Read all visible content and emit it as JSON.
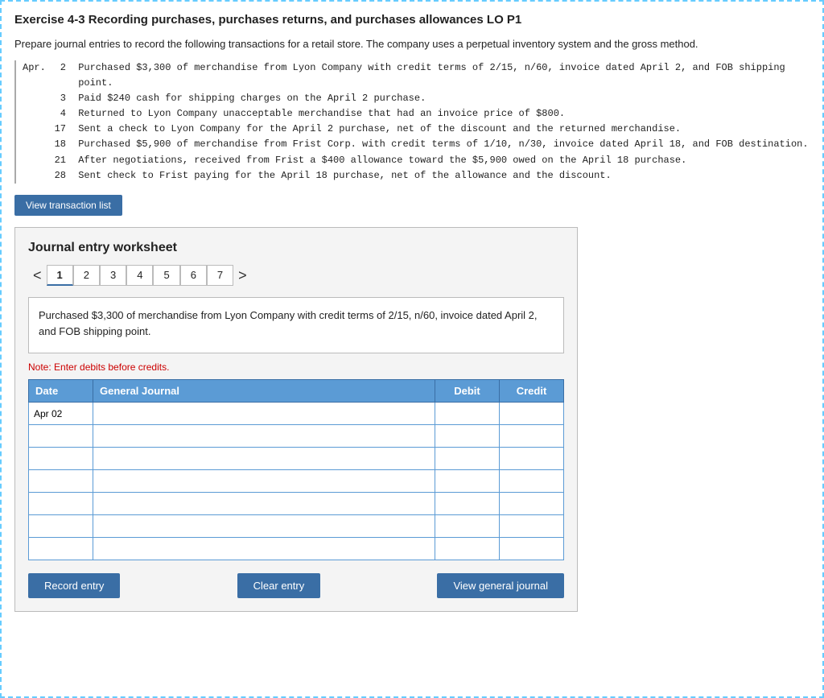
{
  "exercise": {
    "title": "Exercise 4-3 Recording purchases, purchases returns, and purchases allowances LO P1",
    "intro": "Prepare journal entries to record the following transactions for a retail store. The company uses a perpetual inventory system and the gross method.",
    "transactions": [
      {
        "month": "Apr.",
        "day": "2",
        "text": "Purchased $3,300 of merchandise from Lyon Company with credit terms of 2/15, n/60, invoice dated April 2, and FOB shipping point."
      },
      {
        "month": "",
        "day": "3",
        "text": "Paid $240 cash for shipping charges on the April 2 purchase."
      },
      {
        "month": "",
        "day": "4",
        "text": "Returned to Lyon Company unacceptable merchandise that had an invoice price of $800."
      },
      {
        "month": "",
        "day": "17",
        "text": "Sent a check to Lyon Company for the April 2 purchase, net of the discount and the returned merchandise."
      },
      {
        "month": "",
        "day": "18",
        "text": "Purchased $5,900 of merchandise from Frist Corp. with credit terms of 1/10, n/30, invoice dated April 18, and FOB destination."
      },
      {
        "month": "",
        "day": "21",
        "text": "After negotiations, received from Frist a $400 allowance toward the $5,900 owed on the April 18 purchase."
      },
      {
        "month": "",
        "day": "28",
        "text": "Sent check to Frist paying for the April 18 purchase, net of the allowance and the discount."
      }
    ],
    "view_transaction_btn": "View transaction list"
  },
  "worksheet": {
    "title": "Journal entry worksheet",
    "tabs": [
      {
        "label": "1",
        "active": true
      },
      {
        "label": "2"
      },
      {
        "label": "3"
      },
      {
        "label": "4"
      },
      {
        "label": "5"
      },
      {
        "label": "6"
      },
      {
        "label": "7"
      }
    ],
    "current_description": "Purchased $3,300 of merchandise from Lyon Company with credit terms of 2/15, n/60, invoice dated April 2, and FOB shipping point.",
    "note": "Note: Enter debits before credits.",
    "table": {
      "headers": [
        "Date",
        "General Journal",
        "Debit",
        "Credit"
      ],
      "rows": [
        {
          "date": "Apr 02",
          "journal": "",
          "debit": "",
          "credit": ""
        },
        {
          "date": "",
          "journal": "",
          "debit": "",
          "credit": ""
        },
        {
          "date": "",
          "journal": "",
          "debit": "",
          "credit": ""
        },
        {
          "date": "",
          "journal": "",
          "debit": "",
          "credit": ""
        },
        {
          "date": "",
          "journal": "",
          "debit": "",
          "credit": ""
        },
        {
          "date": "",
          "journal": "",
          "debit": "",
          "credit": ""
        },
        {
          "date": "",
          "journal": "",
          "debit": "",
          "credit": ""
        }
      ]
    },
    "buttons": {
      "record": "Record entry",
      "clear": "Clear entry",
      "view_journal": "View general journal"
    }
  }
}
